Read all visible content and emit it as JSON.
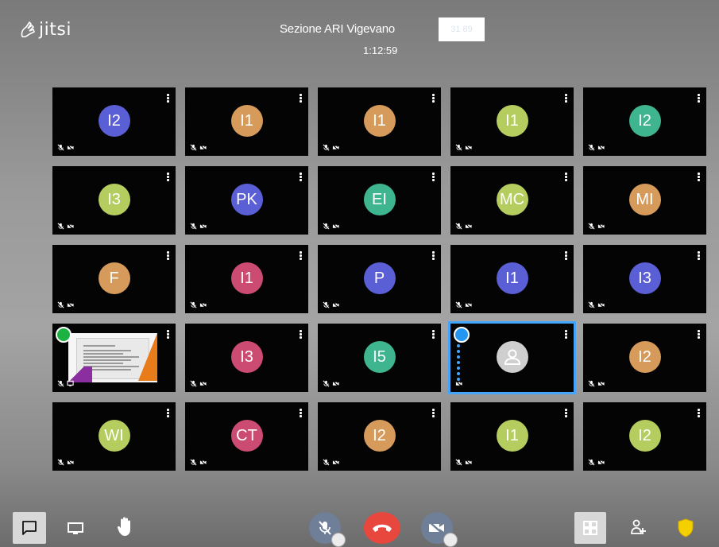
{
  "header": {
    "logo_text": "jitsi",
    "meeting_title": "Sezione ARI Vigevano",
    "badge_text": "31 89",
    "timer": "1:12:59"
  },
  "colors": {
    "purple": "#6a5acd",
    "orange": "#d69b5a",
    "lime": "#b5cc5f",
    "teal": "#3fb58f",
    "pink": "#cb4b72",
    "blue": "#5b5fd6",
    "grey": "#cfcfcf",
    "hangup": "#e8473d",
    "toolbar_round": "#6f7f98",
    "highlight": "#44a5ff"
  },
  "tiles": [
    {
      "initials": "I2",
      "color": "#5b5fd6"
    },
    {
      "initials": "I1",
      "color": "#d69b5a"
    },
    {
      "initials": "I1",
      "color": "#d69b5a"
    },
    {
      "initials": "I1",
      "color": "#b5cc5f"
    },
    {
      "initials": "I2",
      "color": "#3fb58f"
    },
    {
      "initials": "I3",
      "color": "#b5cc5f"
    },
    {
      "initials": "PK",
      "color": "#5b5fd6"
    },
    {
      "initials": "EI",
      "color": "#3fb58f"
    },
    {
      "initials": "MC",
      "color": "#b5cc5f"
    },
    {
      "initials": "MI",
      "color": "#d69b5a"
    },
    {
      "initials": "F",
      "color": "#d69b5a"
    },
    {
      "initials": "I1",
      "color": "#cb4b72"
    },
    {
      "initials": "P",
      "color": "#5b5fd6"
    },
    {
      "initials": "I1",
      "color": "#5b5fd6"
    },
    {
      "initials": "I3",
      "color": "#5b5fd6"
    },
    {
      "initials": "",
      "color": "",
      "screenshare": true
    },
    {
      "initials": "I3",
      "color": "#cb4b72"
    },
    {
      "initials": "I5",
      "color": "#3fb58f"
    },
    {
      "initials": "",
      "color": "#cfcfcf",
      "local": true
    },
    {
      "initials": "I2",
      "color": "#d69b5a"
    },
    {
      "initials": "WI",
      "color": "#b5cc5f"
    },
    {
      "initials": "CT",
      "color": "#cb4b72"
    },
    {
      "initials": "I2",
      "color": "#d69b5a"
    },
    {
      "initials": "I1",
      "color": "#b5cc5f"
    },
    {
      "initials": "I2",
      "color": "#b5cc5f"
    }
  ],
  "toolbar": {
    "left": [
      "chat-icon",
      "screen-share-icon",
      "raise-hand-icon"
    ],
    "center": [
      "microphone-muted-icon",
      "hangup-icon",
      "camera-off-icon"
    ],
    "right": [
      "tile-view-icon",
      "invite-people-icon",
      "security-shield-icon"
    ]
  }
}
